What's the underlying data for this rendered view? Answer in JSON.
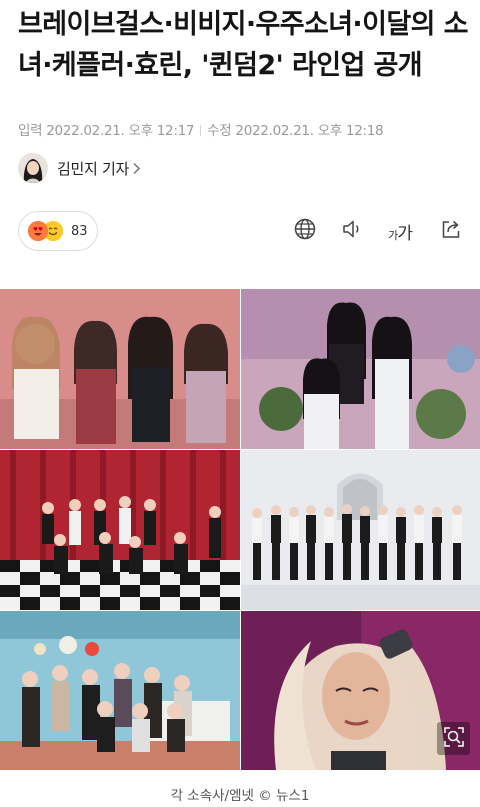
{
  "article": {
    "headline": "브레이브걸스·비비지·우주소녀·이달의 소녀·케플러·효린, '퀸덤2' 라인업 공개",
    "input_label": "입력",
    "input_time": "2022.02.21. 오후 12:17",
    "modified_label": "수정",
    "modified_time": "2022.02.21. 오후 12:18",
    "author": "김민지 기자",
    "photo_caption": "각 소속사/엠넷 © 뉴스1"
  },
  "reactions": {
    "count": "83",
    "icons": [
      "heart-eyes-emoji",
      "smiling-emoji"
    ]
  },
  "toolbar": {
    "icons": [
      "globe-icon",
      "speaker-icon",
      "font-size-icon",
      "share-icon"
    ],
    "font_small": "가",
    "font_large": "가"
  },
  "colors": {
    "headline": "#151515",
    "meta_text": "#9a9a9a",
    "border": "#dcdcdc"
  }
}
